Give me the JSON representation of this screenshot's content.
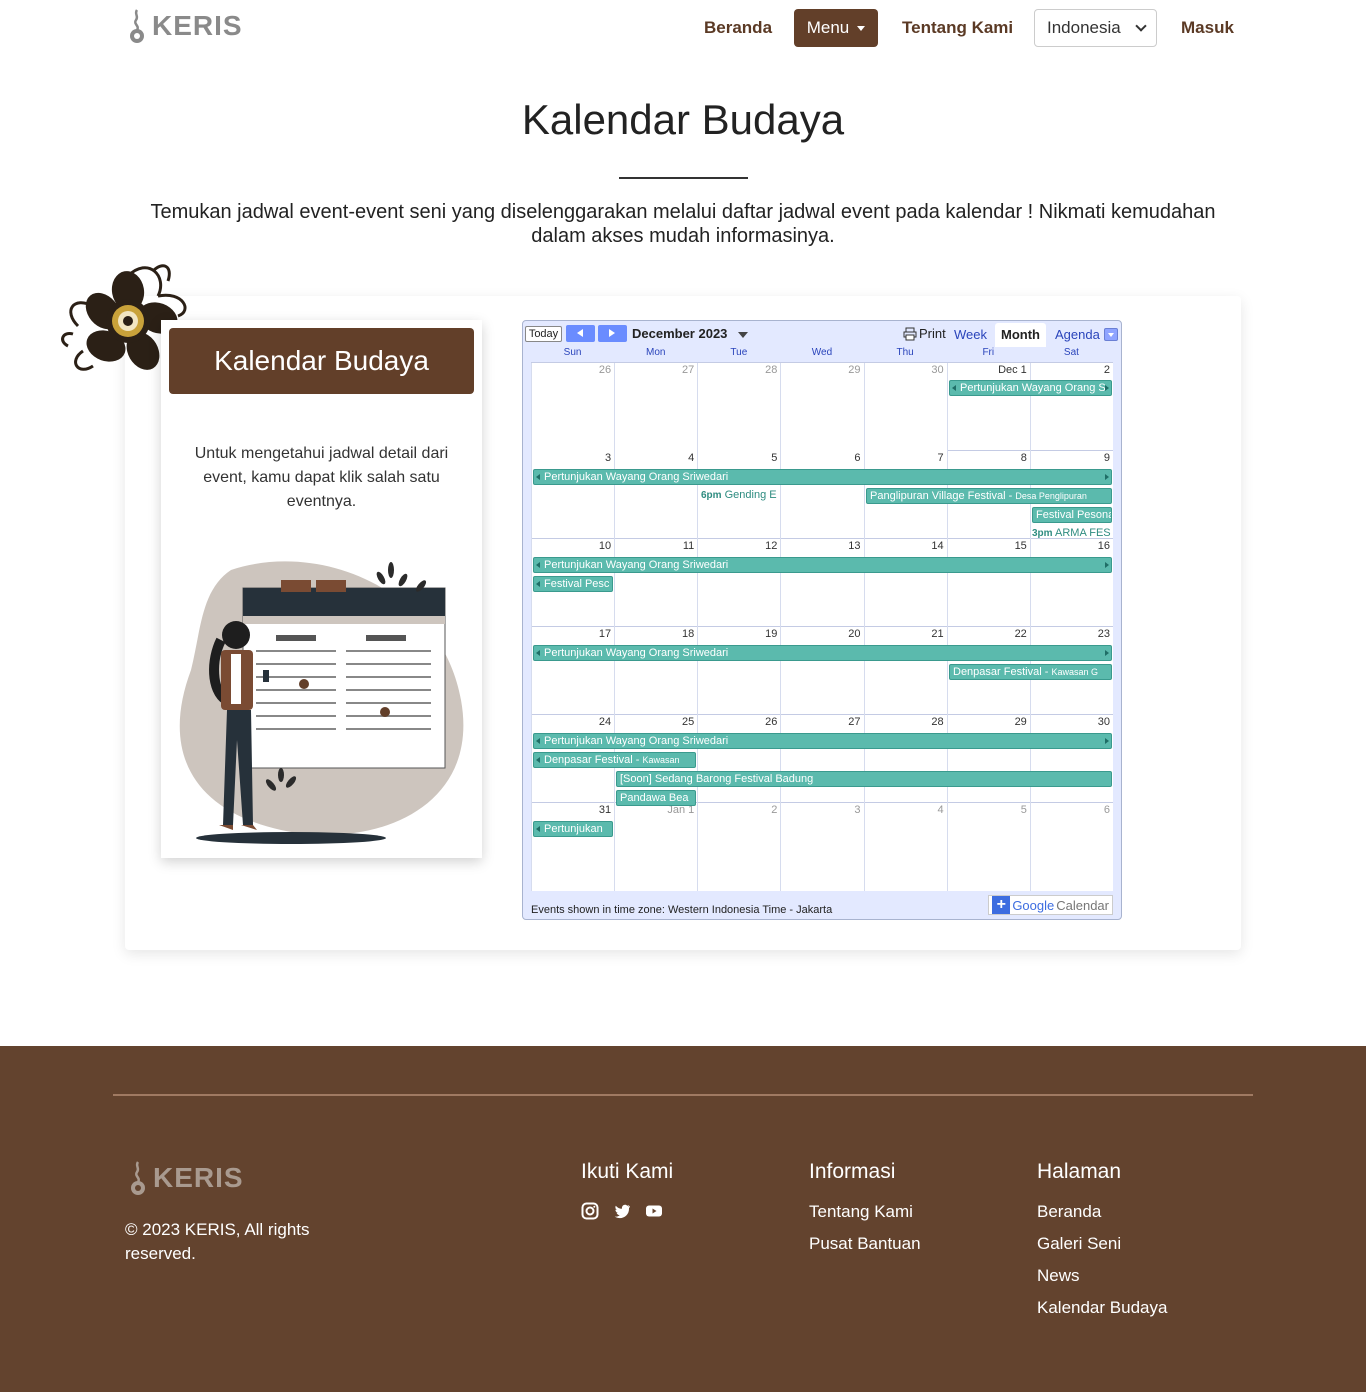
{
  "nav": {
    "brand": "KERIS",
    "links": {
      "home": "Beranda",
      "menu": "Menu",
      "about": "Tentang Kami",
      "login": "Masuk"
    },
    "language": "Indonesia"
  },
  "hero": {
    "title": "Kalendar Budaya",
    "intro": "Temukan jadwal event-event seni yang diselenggarakan melalui daftar jadwal event pada kalendar ! Nikmati kemudahan dalam akses mudah informasinya."
  },
  "panel": {
    "button": "Kalendar Budaya",
    "text": "Untuk mengetahui jadwal detail dari event, kamu dapat klik salah satu eventnya."
  },
  "calendar": {
    "today_label": "Today",
    "month_label": "December 2023",
    "print_label": "Print",
    "tabs": [
      "Week",
      "Month",
      "Agenda"
    ],
    "active_tab": "Month",
    "weekdays": [
      "Sun",
      "Mon",
      "Tue",
      "Wed",
      "Thu",
      "Fri",
      "Sat"
    ],
    "weeks": [
      [
        "26",
        "27",
        "28",
        "29",
        "30",
        "Dec 1",
        "2"
      ],
      [
        "3",
        "4",
        "5",
        "6",
        "7",
        "8",
        "9"
      ],
      [
        "10",
        "11",
        "12",
        "13",
        "14",
        "15",
        "16"
      ],
      [
        "17",
        "18",
        "19",
        "20",
        "21",
        "22",
        "23"
      ],
      [
        "24",
        "25",
        "26",
        "27",
        "28",
        "29",
        "30"
      ],
      [
        "31",
        "Jan 1",
        "2",
        "3",
        "4",
        "5",
        "6"
      ]
    ],
    "events": {
      "wayang_short": "Pertunjukan Wayang Orang S",
      "wayang": "Pertunjukan Wayang Orang Sriwedari",
      "wayang_trunc": "Pertunjukan",
      "gending_time": "6pm",
      "gending": "Gending E",
      "penglipuran": "Panglipuran Village Festival - ",
      "penglipuran_loc": "Desa Penglipuran",
      "pesona": "Festival Pesona",
      "arma_time": "3pm",
      "arma": "ARMA FES",
      "pesona_short": "Festival Pesc",
      "denpasar": "Denpasar Festival - ",
      "denpasar_loc": "Kawasan G",
      "denpasar_loc2": "Kawasan",
      "barong": "[Soon] Sedang Barong Festival Badung",
      "pandawa": "Pandawa Bea"
    },
    "timezone_note": "Events shown in time zone: Western Indonesia Time - Jakarta",
    "google_label": "Google",
    "google_calendar": "Calendar"
  },
  "footer": {
    "brand": "KERIS",
    "copyright": "© 2023 KERIS, All rights reserved.",
    "follow_title": "Ikuti Kami",
    "info_title": "Informasi",
    "info_links": [
      "Tentang Kami",
      "Pusat Bantuan"
    ],
    "pages_title": "Halaman",
    "pages_links": [
      "Beranda",
      "Galeri Seni",
      "News",
      "Kalendar Budaya"
    ],
    "social_icons": [
      "instagram-icon",
      "twitter-icon",
      "youtube-icon"
    ]
  },
  "colors": {
    "brand_brown": "#623f29",
    "footer_brown": "#63432e",
    "event_teal": "#5bbaad",
    "calendar_blue": "#e3e9ff"
  }
}
